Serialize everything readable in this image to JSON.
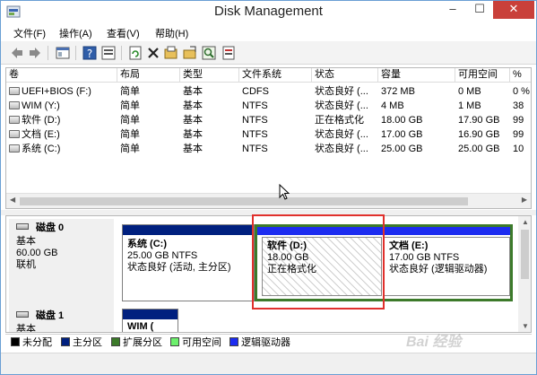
{
  "window": {
    "title": "Disk Management",
    "controls": [
      "–",
      "☐",
      "✕"
    ]
  },
  "menu": [
    "文件(F)",
    "操作(A)",
    "查看(V)",
    "帮助(H)"
  ],
  "toolbar_icons": [
    "back-icon",
    "forward-icon",
    "console-icon",
    "help-icon",
    "properties-icon",
    "refresh-icon",
    "delete-icon",
    "open-icon",
    "explore-icon",
    "search-icon",
    "rescan-icon"
  ],
  "columns": [
    "卷",
    "布局",
    "类型",
    "文件系统",
    "状态",
    "容量",
    "可用空间",
    "%"
  ],
  "volumes": [
    {
      "name": "UEFI+BIOS (F:)",
      "layout": "简单",
      "type": "基本",
      "fs": "CDFS",
      "status": "状态良好 (...",
      "capacity": "372 MB",
      "free": "0 MB",
      "pct": "0 %"
    },
    {
      "name": "WIM (Y:)",
      "layout": "简单",
      "type": "基本",
      "fs": "NTFS",
      "status": "状态良好 (...",
      "capacity": "4 MB",
      "free": "1 MB",
      "pct": "38"
    },
    {
      "name": "软件 (D:)",
      "layout": "简单",
      "type": "基本",
      "fs": "NTFS",
      "status": "正在格式化",
      "capacity": "18.00 GB",
      "free": "17.90 GB",
      "pct": "99"
    },
    {
      "name": "文档 (E:)",
      "layout": "简单",
      "type": "基本",
      "fs": "NTFS",
      "status": "状态良好 (...",
      "capacity": "17.00 GB",
      "free": "16.90 GB",
      "pct": "99"
    },
    {
      "name": "系统 (C:)",
      "layout": "简单",
      "type": "基本",
      "fs": "NTFS",
      "status": "状态良好 (...",
      "capacity": "25.00 GB",
      "free": "25.00 GB",
      "pct": "10"
    }
  ],
  "disks": [
    {
      "name": "磁盘 0",
      "type": "基本",
      "size": "60.00 GB",
      "state": "联机",
      "partitions": [
        {
          "name": "系统 (C:)",
          "size": "25.00 GB NTFS",
          "status": "状态良好 (活动, 主分区)"
        },
        {
          "name": "软件 (D:)",
          "size": "18.00 GB",
          "status": "正在格式化"
        },
        {
          "name": "文档 (E:)",
          "size": "17.00 GB NTFS",
          "status": "状态良好 (逻辑驱动器)"
        }
      ]
    },
    {
      "name": "磁盘 1",
      "type": "基本",
      "partitions": [
        {
          "name": "WIM ("
        }
      ]
    }
  ],
  "legend": [
    {
      "label": "未分配",
      "color": "#000000"
    },
    {
      "label": "主分区",
      "color": "#00207f"
    },
    {
      "label": "扩展分区",
      "color": "#3c7a2a"
    },
    {
      "label": "可用空间",
      "color": "#6cf06c"
    },
    {
      "label": "逻辑驱动器",
      "color": "#1c2cf0"
    }
  ],
  "watermark": "Bai 经验"
}
